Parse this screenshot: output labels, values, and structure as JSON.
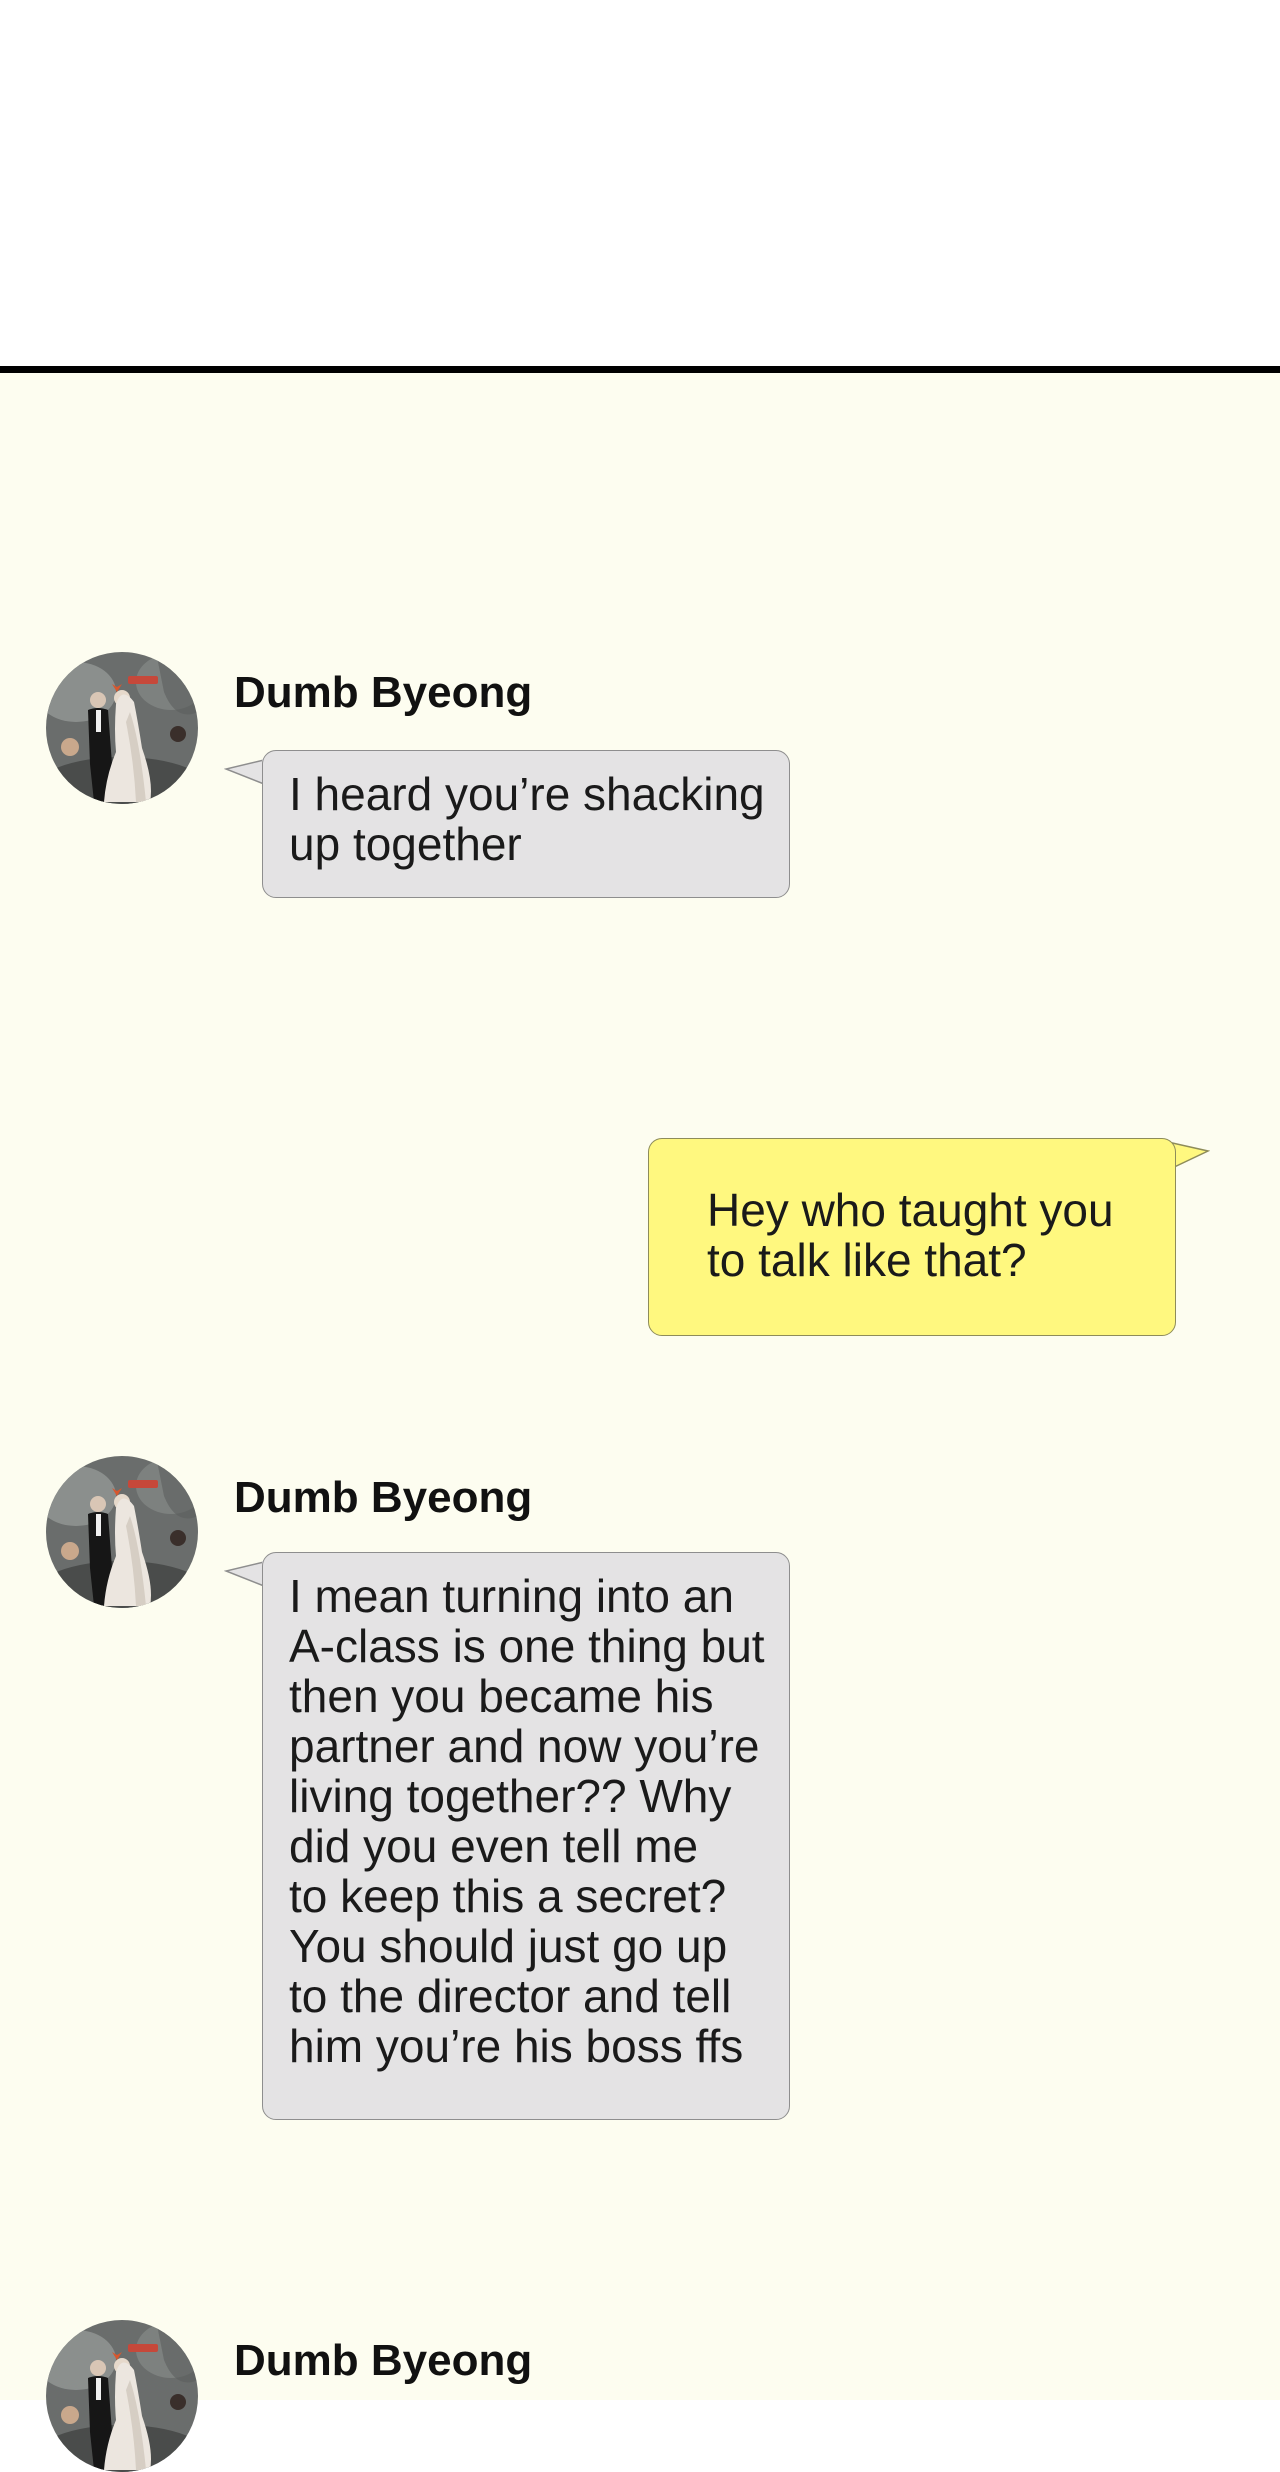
{
  "chat": {
    "messages": [
      {
        "sender": "Dumb Byeong",
        "direction": "incoming",
        "text": "I heard you’re shacking\nup together"
      },
      {
        "direction": "outgoing",
        "text": "Hey who taught you\nto talk like that?"
      },
      {
        "sender": "Dumb Byeong",
        "direction": "incoming",
        "text": "I mean turning into an\nA-class is one thing but\nthen you became his\npartner and now you’re\nliving together?? Why\ndid you even tell me\nto keep this a secret?\nYou should just go up\nto the director and tell\nhim you’re his boss ffs"
      },
      {
        "sender": "Dumb Byeong",
        "direction": "incoming"
      }
    ]
  },
  "colors": {
    "chat_background": "#fdfdf0",
    "incoming_bubble": "#e4e3e4",
    "outgoing_bubble": "#fff87f",
    "divider": "#000000"
  },
  "icons": {
    "avatar": "wedding-couple-photo-avatar"
  }
}
